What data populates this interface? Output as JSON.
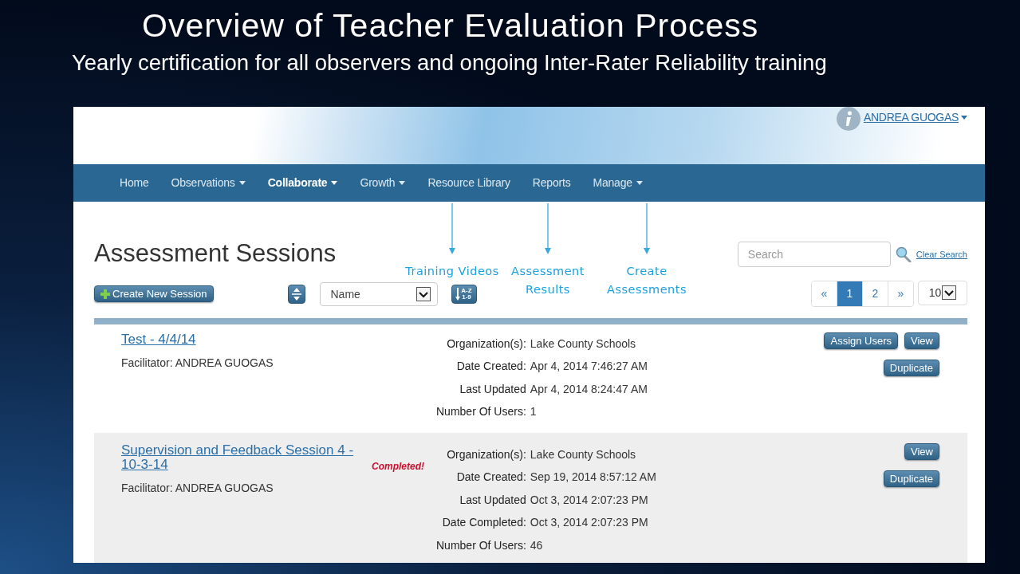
{
  "slide": {
    "title": "Overview of Teacher Evaluation Process",
    "subtitle": "Yearly certification for all observers and ongoing Inter-Rater Reliability training"
  },
  "app": {
    "user_name": "ANDREA GUOGAS",
    "nav": [
      {
        "label": "Home",
        "dropdown": false,
        "selected": false
      },
      {
        "label": "Observations",
        "dropdown": true,
        "selected": false
      },
      {
        "label": "Collaborate",
        "dropdown": true,
        "selected": true
      },
      {
        "label": "Growth",
        "dropdown": true,
        "selected": false
      },
      {
        "label": "Resource Library",
        "dropdown": false,
        "selected": false
      },
      {
        "label": "Reports",
        "dropdown": false,
        "selected": false
      },
      {
        "label": "Manage",
        "dropdown": true,
        "selected": false
      }
    ],
    "page_title": "Assessment Sessions",
    "create_button": "Create New Session",
    "sort_field": "Name",
    "sort_order": {
      "top": "A-Z",
      "bottom": "1-9"
    },
    "search": {
      "placeholder": "Search"
    },
    "clear_search": "Clear Search",
    "pagination": [
      {
        "label": "«",
        "selected": false
      },
      {
        "label": "1",
        "selected": true
      },
      {
        "label": "2",
        "selected": false
      },
      {
        "label": "»",
        "selected": false
      }
    ],
    "page_size": "10",
    "sessions": [
      {
        "title": "Test - 4/4/14",
        "facilitator_label": "Facilitator:",
        "facilitator": "ANDREA GUOGAS",
        "fields": [
          {
            "label": "Organization(s):",
            "value": "Lake County Schools"
          },
          {
            "label": "Date Created:",
            "value": "Apr 4, 2014 7:46:27 AM"
          },
          {
            "label": "Last Updated",
            "value": "Apr 4, 2014 8:24:47 AM"
          },
          {
            "label": "Number Of Users:",
            "value": "1"
          }
        ],
        "buttons": [
          [
            "Assign Users",
            "View"
          ],
          [
            "Duplicate"
          ]
        ]
      },
      {
        "title": "Supervision and Feedback Session 4 - 10-3-14",
        "status": "Completed!",
        "facilitator_label": "Facilitator:",
        "facilitator": "ANDREA GUOGAS",
        "fields": [
          {
            "label": "Organization(s):",
            "value": "Lake County Schools"
          },
          {
            "label": "Date Created:",
            "value": "Sep 19, 2014 8:57:12 AM"
          },
          {
            "label": "Last Updated",
            "value": "Oct 3, 2014 2:07:23 PM"
          },
          {
            "label": "Date Completed:",
            "value": "Oct 3, 2014 2:07:23 PM"
          },
          {
            "label": "Number Of Users:",
            "value": "46"
          }
        ],
        "buttons": [
          [
            "View"
          ],
          [
            "Duplicate"
          ]
        ]
      }
    ]
  },
  "annotations": [
    {
      "text": "Training Videos"
    },
    {
      "text": "Assessment Results"
    },
    {
      "text": "Create Assessments"
    }
  ]
}
